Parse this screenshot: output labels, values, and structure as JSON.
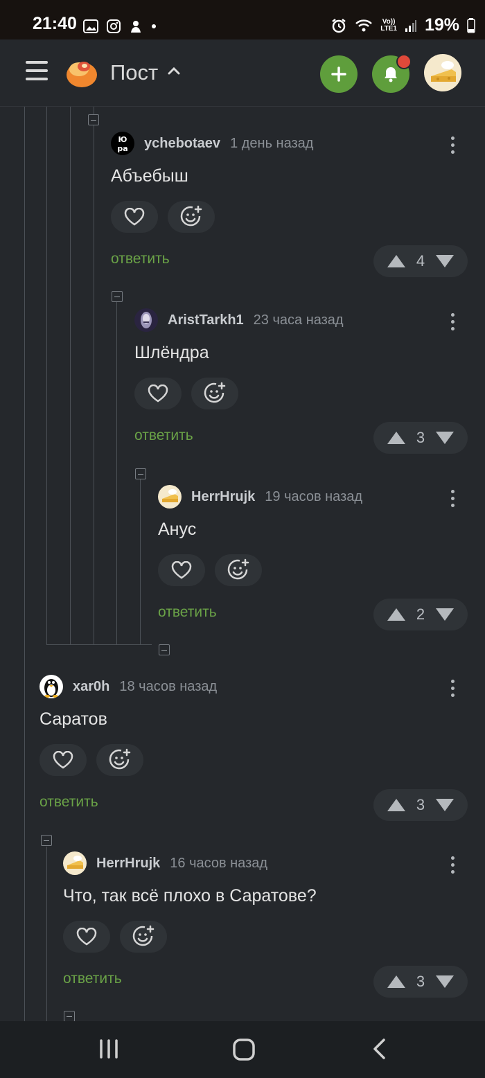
{
  "status_bar": {
    "time": "21:40",
    "battery_text": "19%",
    "network": "Vo))\nLTE1"
  },
  "topbar": {
    "title": "Пост"
  },
  "comments": [
    {
      "author": "ychebotaev",
      "time": "1 день назад",
      "text": "Абъебыш",
      "reply_label": "ответить",
      "score": "4",
      "avatar_text": "Ю ра"
    },
    {
      "author": "AristTarkh1",
      "time": "23 часа назад",
      "text": "Шлёндра",
      "reply_label": "ответить",
      "score": "3"
    },
    {
      "author": "HerrHrujk",
      "time": "19 часов назад",
      "text": "Анус",
      "reply_label": "ответить",
      "score": "2"
    },
    {
      "author": "xar0h",
      "time": "18 часов назад",
      "text": "Саратов",
      "reply_label": "ответить",
      "score": "3"
    },
    {
      "author": "HerrHrujk",
      "time": "16 часов назад",
      "text": "Что, так всё плохо в Саратове?",
      "reply_label": "ответить",
      "score": "3"
    }
  ],
  "icons": {
    "like": "heart-icon",
    "react": "emoji-add-icon",
    "more": "more-vertical-icon",
    "upvote": "triangle-up-icon",
    "downvote": "triangle-down-icon",
    "collapse": "minus-square-icon"
  },
  "colors": {
    "background": "#25282c",
    "accent": "#5f9e3c",
    "reply": "#6aa247",
    "notification": "#e0493a"
  }
}
